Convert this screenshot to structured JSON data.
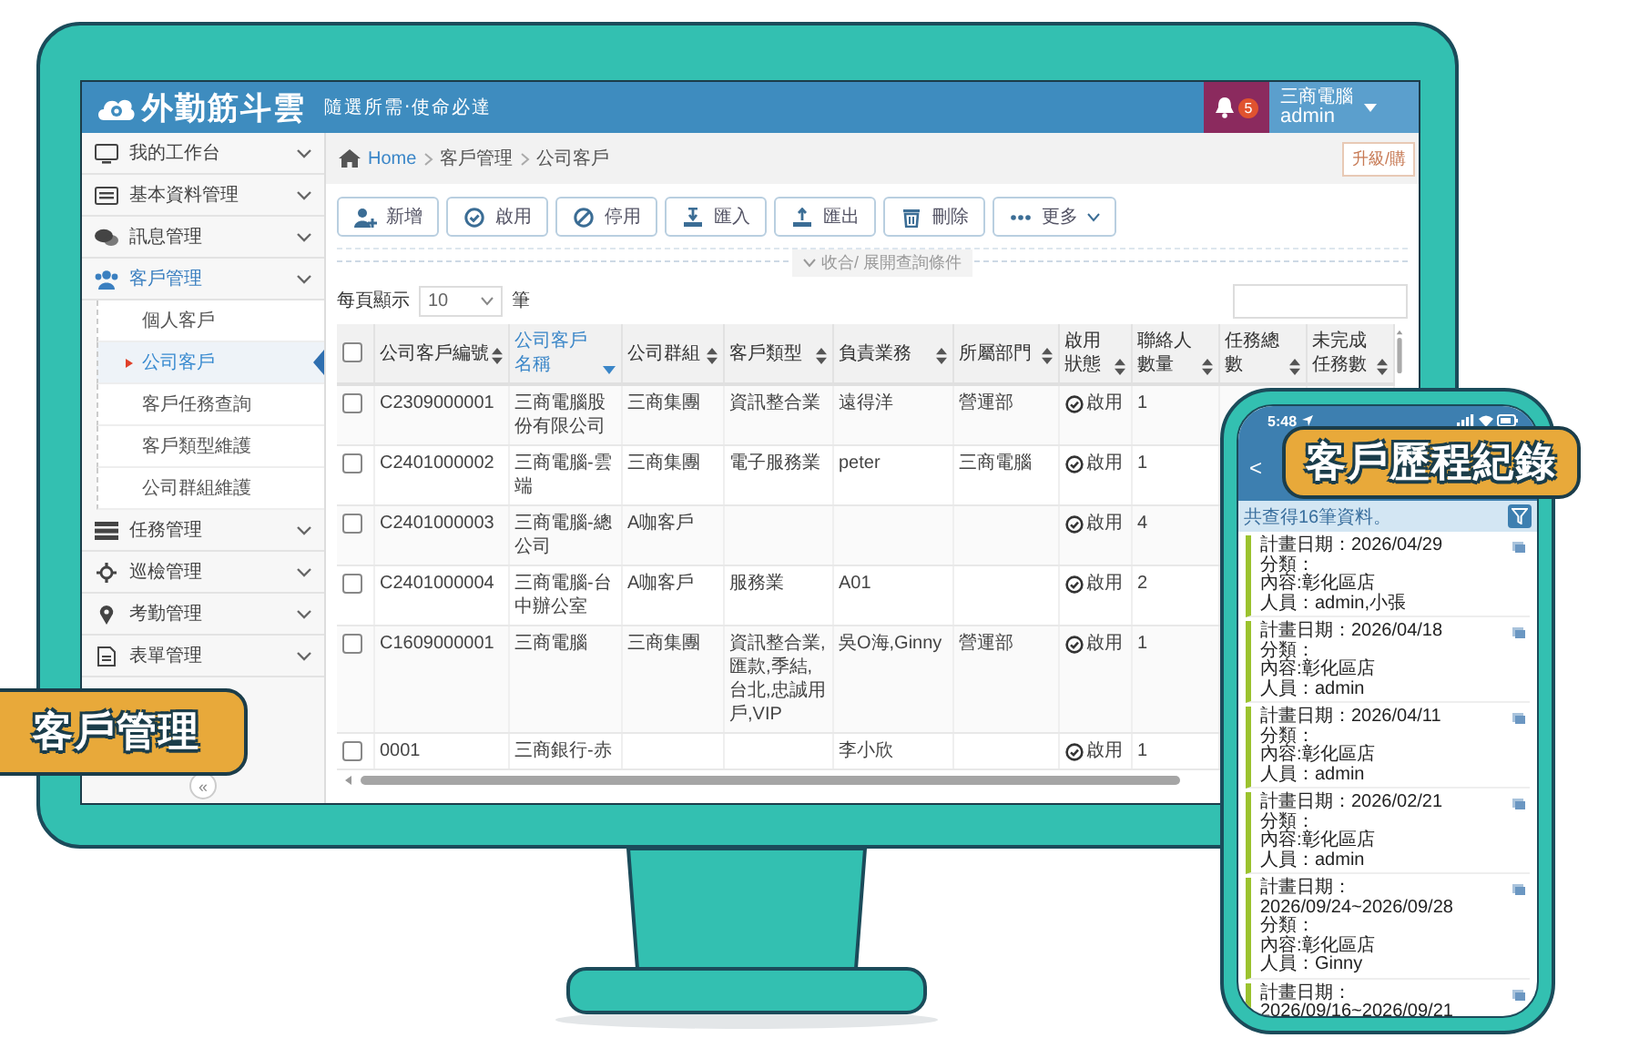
{
  "app": {
    "logo": "外勤筋斗雲",
    "tagline": "隨選所需‧使命必達",
    "notifications": "5",
    "user_company": "三商電腦",
    "user_name": "admin"
  },
  "sidebar": {
    "items": [
      {
        "label": "我的工作台",
        "expanded": false
      },
      {
        "label": "基本資料管理",
        "expanded": false
      },
      {
        "label": "訊息管理",
        "expanded": false
      },
      {
        "label": "客戶管理",
        "expanded": true,
        "children": [
          {
            "label": "個人客戶",
            "selected": false
          },
          {
            "label": "公司客戶",
            "selected": true
          },
          {
            "label": "客戶任務查詢",
            "selected": false
          },
          {
            "label": "客戶類型維護",
            "selected": false
          },
          {
            "label": "公司群組維護",
            "selected": false
          }
        ]
      },
      {
        "label": "任務管理",
        "expanded": false
      },
      {
        "label": "巡檢管理",
        "expanded": false
      },
      {
        "label": "考勤管理",
        "expanded": false
      },
      {
        "label": "表單管理",
        "expanded": false
      }
    ],
    "collapse": "«"
  },
  "breadcrumb": [
    "Home",
    "客戶管理",
    "公司客戶"
  ],
  "upgrade_button": "升級/購",
  "toolbar": [
    {
      "label": "新增",
      "kind": "action"
    },
    {
      "label": "啟用",
      "kind": "action"
    },
    {
      "label": "停用",
      "kind": "action"
    },
    {
      "label": "匯入",
      "kind": "action"
    },
    {
      "label": "匯出",
      "kind": "action"
    },
    {
      "label": "刪除",
      "kind": "action"
    },
    {
      "label": "更多",
      "kind": "menu"
    }
  ],
  "filter_toggle": "收合/ 展開查詢條件",
  "page_size": {
    "label": "每頁顯示",
    "value": "10",
    "unit": "筆"
  },
  "table": {
    "header_checked": false,
    "columns": [
      {
        "label": "公司客戶編號",
        "sorted": false
      },
      {
        "label": "公司客戶名稱",
        "sorted": true
      },
      {
        "label": "公司群組",
        "sorted": false
      },
      {
        "label": "客戶類型",
        "sorted": false
      },
      {
        "label": "負責業務",
        "sorted": false
      },
      {
        "label": "所屬部門",
        "sorted": false
      },
      {
        "label": "啟用狀態",
        "sorted": false
      },
      {
        "label": "聯絡人數量",
        "sorted": false
      },
      {
        "label": "任務總數",
        "sorted": false
      },
      {
        "label": "未完成任務數",
        "sorted": false
      }
    ],
    "rows": [
      {
        "checked": false,
        "id": "C2309000001",
        "name": "三商電腦股份有限公司",
        "group": "三商集團",
        "type": "資訊整合業",
        "owner": "遠得洋",
        "dept": "營運部",
        "status": "啟用",
        "contacts": "1"
      },
      {
        "checked": false,
        "id": "C2401000002",
        "name": "三商電腦-雲端",
        "group": "三商集團",
        "type": "電子服務業",
        "owner": "peter",
        "dept": "三商電腦",
        "status": "啟用",
        "contacts": "1"
      },
      {
        "checked": false,
        "id": "C2401000003",
        "name": "三商電腦-總公司",
        "group": "A咖客戶",
        "status": "啟用",
        "contacts": "4"
      },
      {
        "checked": false,
        "id": "C2401000004",
        "name": "三商電腦-台中辦公室",
        "group": "A咖客戶",
        "type": "服務業",
        "owner": "A01",
        "status": "啟用",
        "contacts": "2"
      },
      {
        "checked": false,
        "id": "C1609000001",
        "name": "三商電腦",
        "group": "三商集團",
        "type": "資訊整合業,匯款,季結,台北,忠誠用戶,VIP",
        "owner": "吳O海,Ginny",
        "dept": "營運部",
        "status": "啟用",
        "contacts": "1"
      },
      {
        "checked": false,
        "id": "0001",
        "name": "三商銀行-赤",
        "owner": "李小欣",
        "status": "啟用",
        "contacts": "1"
      }
    ]
  },
  "phone": {
    "time": "5:48",
    "back": "<",
    "count_text": "共查得16筆資料。",
    "records": [
      {
        "date": "計畫日期：2026/04/29",
        "category": "分類：",
        "content": "內容:彰化區店",
        "people": "人員：admin,小張"
      },
      {
        "date": "計畫日期：2026/04/18",
        "category": "分類：",
        "content": "內容:彰化區店",
        "people": "人員：admin"
      },
      {
        "date": "計畫日期：2026/04/11",
        "category": "分類：",
        "content": "內容:彰化區店",
        "people": "人員：admin"
      },
      {
        "date": "計畫日期：2026/02/21",
        "category": "分類：",
        "content": "內容:彰化區店",
        "people": "人員：admin"
      },
      {
        "date": "計畫日期：2026/09/24~2026/09/28",
        "category": "分類：",
        "content": "內容:彰化區店",
        "people": "人員：Ginny"
      },
      {
        "date": "計畫日期：2026/09/16~2026/09/21"
      }
    ]
  },
  "banners": {
    "left": "客戶管理",
    "right": "客戶歷程紀錄"
  }
}
